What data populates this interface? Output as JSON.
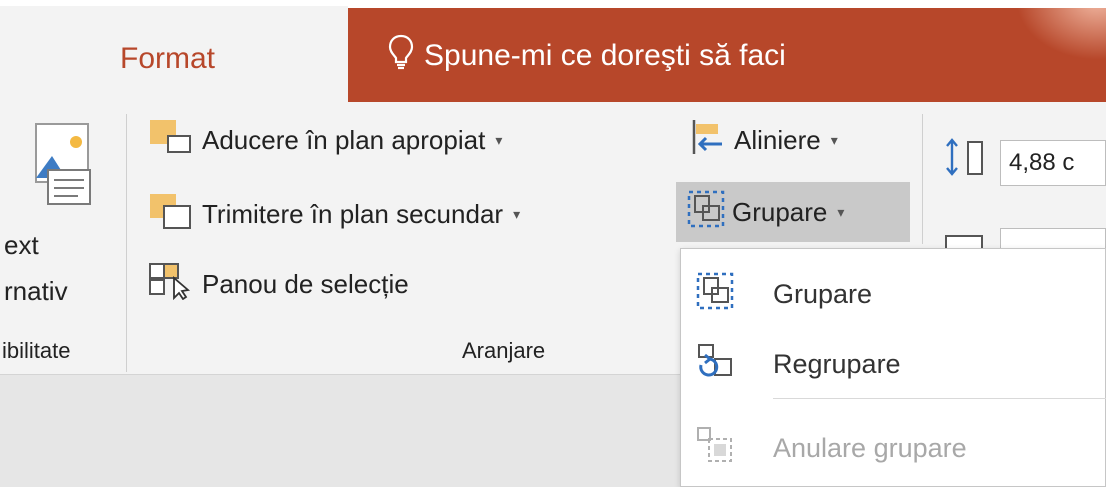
{
  "tabs": {
    "format_label": "Format",
    "search_label": "Spune-mi ce doreşti să faci"
  },
  "accessibility": {
    "alt_text_line1": "ext",
    "alt_text_line2": "rnativ",
    "group_label": "ibilitate"
  },
  "arrange": {
    "bring_forward": "Aducere în plan apropiat",
    "send_backward": "Trimitere în plan secundar",
    "selection_pane": "Panou de selecție",
    "align": "Aliniere",
    "group": "Grupare",
    "group_label": "Aranjare"
  },
  "size": {
    "height_value": "4,88 c"
  },
  "group_menu": {
    "items": [
      {
        "label": "Grupare",
        "icon": "group-icon",
        "enabled": true
      },
      {
        "label": "Regrupare",
        "icon": "regroup-icon",
        "enabled": true
      },
      {
        "label": "Anulare grupare",
        "icon": "ungroup-icon",
        "enabled": false
      }
    ]
  },
  "colors": {
    "accent": "#b7472a",
    "ribbon_bg": "#f3f3f3",
    "disabled": "#a8a8a8"
  }
}
